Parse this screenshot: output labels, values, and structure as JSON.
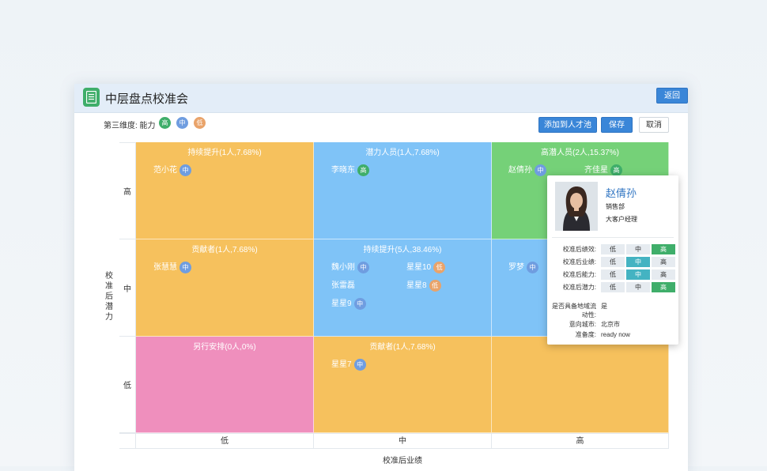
{
  "header": {
    "title": "中层盘点校准会",
    "back_label": "返回"
  },
  "toolbar": {
    "dimension_label": "第三维度: 能力",
    "legend": [
      {
        "label": "高",
        "color": "#3fae6a"
      },
      {
        "label": "中",
        "color": "#6f9de0"
      },
      {
        "label": "低",
        "color": "#e9a36a"
      }
    ],
    "add_pool_label": "添加到人才池",
    "save_label": "保存",
    "cancel_label": "取消"
  },
  "grid": {
    "y_axis_title": "校准后潜力",
    "x_axis_title": "校准后业绩",
    "y_levels": [
      "高",
      "中",
      "低"
    ],
    "x_levels": [
      "低",
      "中",
      "高"
    ],
    "cells": [
      {
        "title": "持续提升(1人,7.68%)",
        "color": "#f6c15d",
        "people": [
          {
            "name": "范小花",
            "level": "中"
          }
        ]
      },
      {
        "title": "潜力人员(1人,7.68%)",
        "color": "#7fc3f7",
        "people": [
          {
            "name": "李晓东",
            "level": "高"
          }
        ]
      },
      {
        "title": "高潜人员(2人,15.37%)",
        "color": "#75d178",
        "people": [
          {
            "name": "赵倩孙",
            "level": "中"
          },
          {
            "name": "齐佳星",
            "level": "高"
          }
        ]
      },
      {
        "title": "贡献者(1人,7.68%)",
        "color": "#f6c15d",
        "people": [
          {
            "name": "张慧慧",
            "level": "中"
          }
        ]
      },
      {
        "title": "持续提升(5人,38.46%)",
        "color": "#7fc3f7",
        "people": [
          {
            "name": "魏小刚",
            "level": "中"
          },
          {
            "name": "星星10",
            "level": "低"
          },
          {
            "name": "张雷磊",
            "level": ""
          },
          {
            "name": "星星8",
            "level": "低"
          },
          {
            "name": "星星9",
            "level": "中"
          }
        ]
      },
      {
        "title": "",
        "color": "#7fc3f7",
        "people": [
          {
            "name": "罗梦",
            "level": "中"
          }
        ]
      },
      {
        "title": "另行安排(0人,0%)",
        "color": "#ef8fbd",
        "people": []
      },
      {
        "title": "贡献者(1人,7.68%)",
        "color": "#f6c15d",
        "people": [
          {
            "name": "星星7",
            "level": "中"
          }
        ]
      },
      {
        "title": "",
        "color": "#f6c15d",
        "people": []
      }
    ]
  },
  "profile_card": {
    "name": "赵倩孙",
    "department": "销售部",
    "position": "大客户经理",
    "ratings": [
      {
        "label": "校准后绩效:",
        "options": [
          "低",
          "中",
          "高"
        ],
        "selected": "高"
      },
      {
        "label": "校准后业绩:",
        "options": [
          "低",
          "中",
          "高"
        ],
        "selected": "中"
      },
      {
        "label": "校准后能力:",
        "options": [
          "低",
          "中",
          "高"
        ],
        "selected": "中"
      },
      {
        "label": "校准后潜力:",
        "options": [
          "低",
          "中",
          "高"
        ],
        "selected": "高"
      }
    ],
    "info": [
      {
        "label": "是否具备地域流动性:",
        "value": "是"
      },
      {
        "label": "意向城市:",
        "value": "北京市"
      },
      {
        "label": "准备度:",
        "value": "ready now"
      }
    ]
  }
}
